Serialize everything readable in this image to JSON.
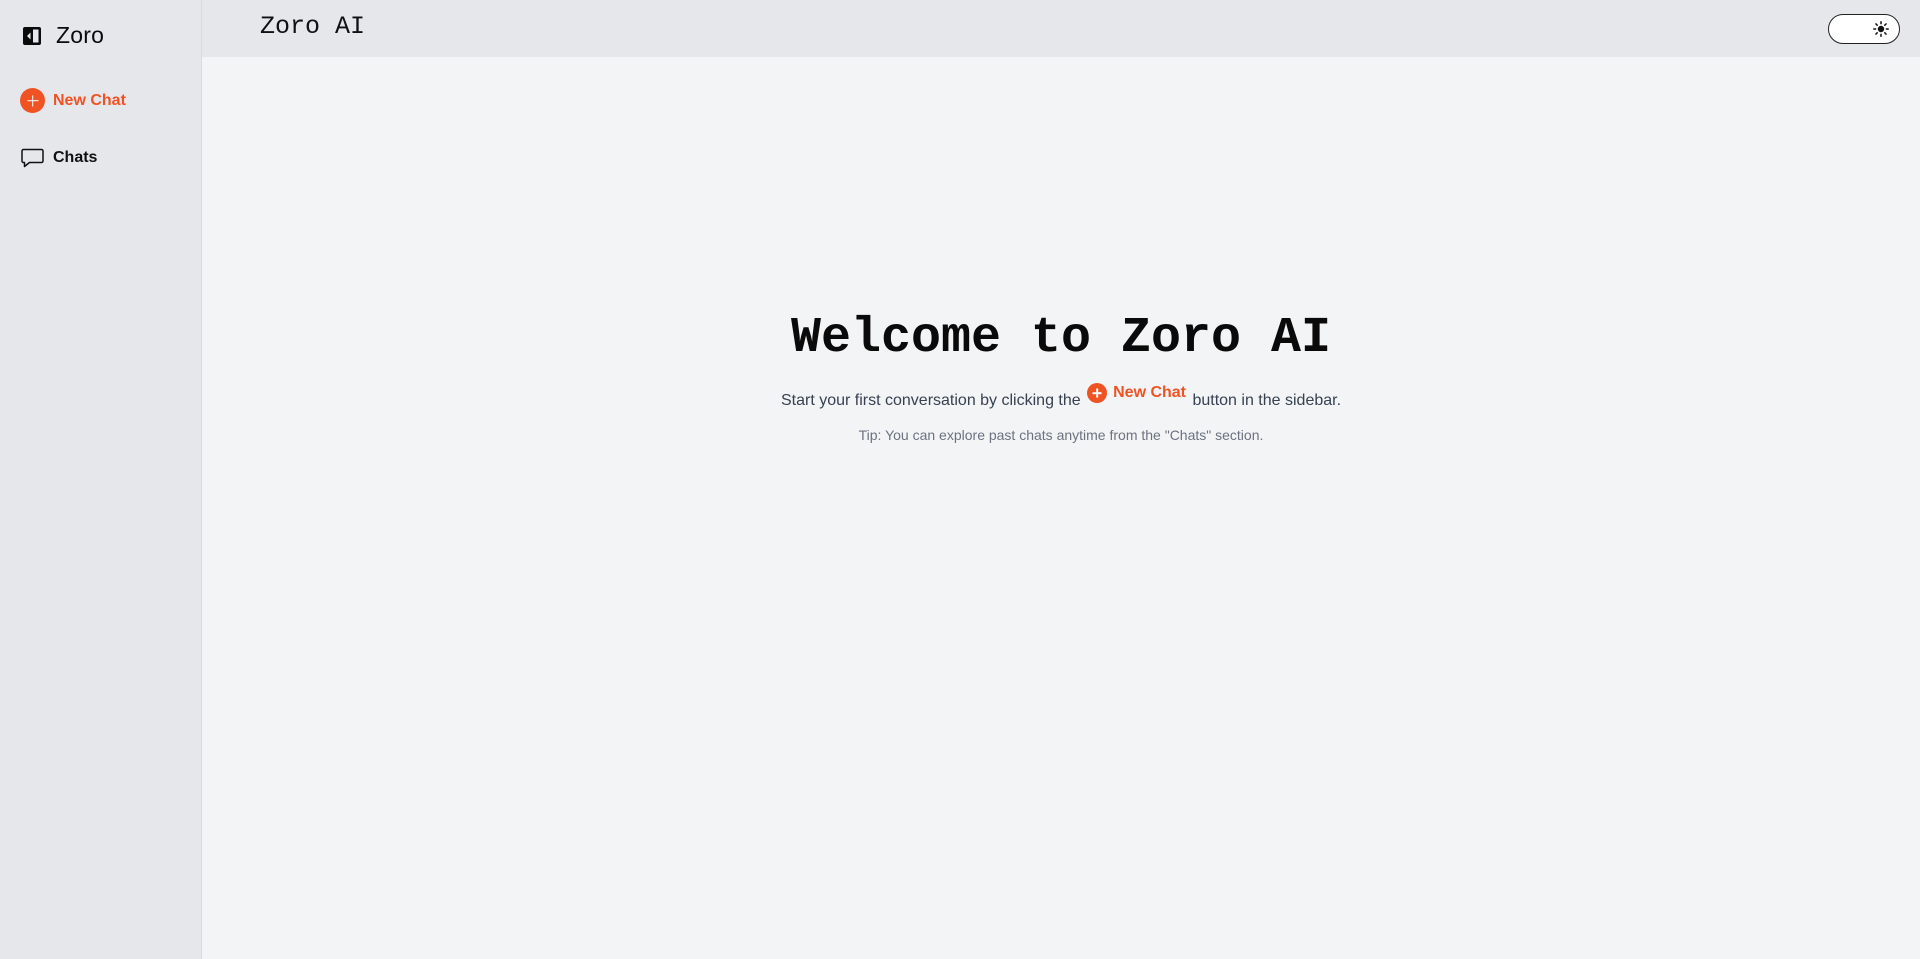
{
  "sidebar": {
    "brand": "Zoro",
    "brand_icon": "sidebar-toggle-icon",
    "items": [
      {
        "label": "New Chat",
        "icon": "plus-circle-icon"
      },
      {
        "label": "Chats",
        "icon": "chat-bubble-icon"
      }
    ]
  },
  "header": {
    "title": "Zoro AI",
    "theme_toggle_icon": "sun-icon"
  },
  "main": {
    "welcome": "Welcome to Zoro AI",
    "subtitle_before": "Start your first conversation by clicking the",
    "subtitle_button": "New Chat",
    "subtitle_after": "button in the sidebar.",
    "tip": "Tip: You can explore past chats anytime from the \"Chats\" section."
  },
  "colors": {
    "accent": "#f05323",
    "sidebar_bg": "#e5e7eb",
    "main_bg": "#f3f4f6"
  }
}
